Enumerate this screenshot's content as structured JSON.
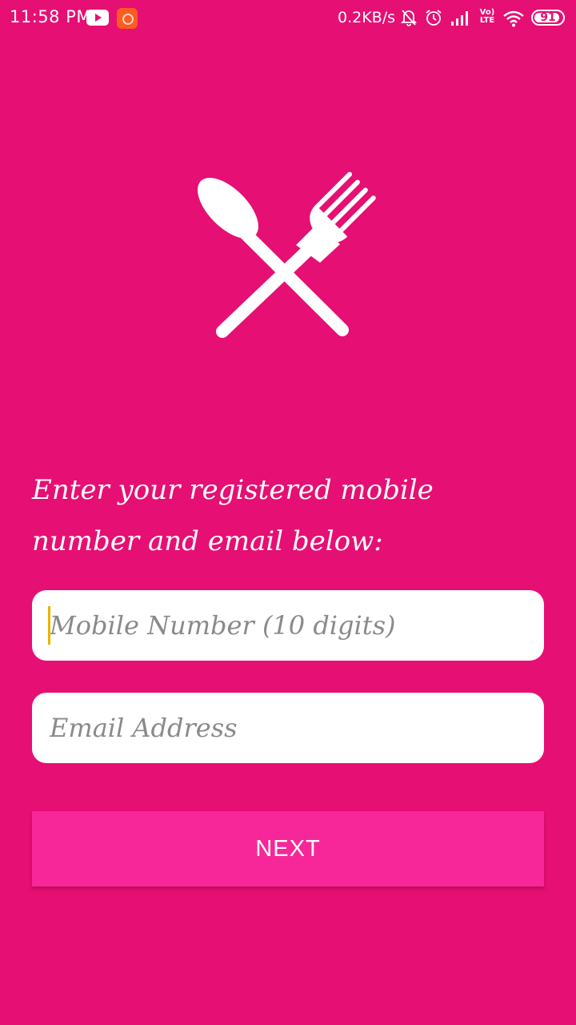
{
  "status_bar": {
    "time": "11:58 PM",
    "net_speed": "0.2KB/s",
    "volte_top": "Vo)",
    "volte_bottom": "LTE",
    "battery_level": "91",
    "icons": [
      "youtube-icon",
      "app-notification-icon",
      "bell-muted-icon",
      "alarm-icon",
      "signal-icon",
      "wifi-icon",
      "battery-icon"
    ]
  },
  "logo": {
    "icon": "spoon-fork-crossed-icon"
  },
  "prompt": {
    "text": "Enter your registered mobile number and email below:"
  },
  "form": {
    "mobile_placeholder": "Mobile Number (10 digits)",
    "mobile_value": "",
    "email_placeholder": "Email Address",
    "email_value": "",
    "next_label": "NEXT"
  },
  "colors": {
    "background": "#e60f73",
    "button": "#f7279a",
    "input_background": "#ffffff",
    "placeholder": "#8a8a8a",
    "cursor": "#e8b400"
  }
}
